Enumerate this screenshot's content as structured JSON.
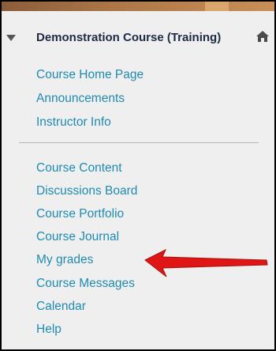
{
  "course": {
    "title": "Demonstration Course (Training)"
  },
  "menu": {
    "group1": [
      {
        "id": "course-home-page",
        "label": "Course Home Page"
      },
      {
        "id": "announcements",
        "label": "Announcements"
      },
      {
        "id": "instructor-info",
        "label": "Instructor Info"
      }
    ],
    "group2": [
      {
        "id": "course-content",
        "label": "Course Content"
      },
      {
        "id": "discussions-board",
        "label": "Discussions Board"
      },
      {
        "id": "course-portfolio",
        "label": "Course Portfolio"
      },
      {
        "id": "course-journal",
        "label": "Course Journal"
      },
      {
        "id": "my-grades",
        "label": "My grades"
      },
      {
        "id": "course-messages",
        "label": "Course Messages"
      },
      {
        "id": "calendar",
        "label": "Calendar"
      },
      {
        "id": "help",
        "label": "Help"
      }
    ]
  },
  "icons": {
    "collapse": "caret-down-icon",
    "home": "home-icon",
    "pointer": "red-arrow-icon"
  },
  "colors": {
    "link": "#1f8bb0",
    "title": "#1f2a44",
    "panel_bg": "#efefef",
    "arrow": "#e01515"
  }
}
